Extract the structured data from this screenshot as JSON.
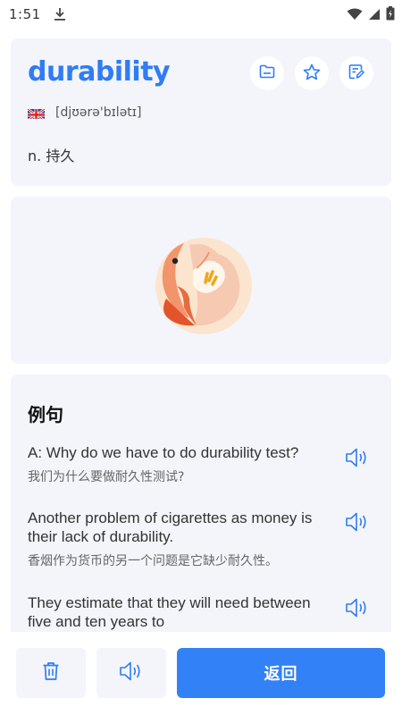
{
  "status_bar": {
    "time": "1:51"
  },
  "word_card": {
    "word": "durability",
    "phonetic": "[djʊərə'bɪlətɪ]",
    "definition": "n. 持久"
  },
  "examples": {
    "title": "例句",
    "items": [
      {
        "en": "A: Why do we have to do durability test?",
        "zh": "我们为什么要做耐久性测试?"
      },
      {
        "en": "Another problem of cigarettes as money is their lack of durability.",
        "zh": "香烟作为货币的另一个问题是它缺少耐久性。"
      },
      {
        "en": "They estimate that they will need between five and ten years to",
        "zh": ""
      }
    ]
  },
  "bottom_bar": {
    "back_label": "返回"
  },
  "colors": {
    "accent": "#2f7cf5",
    "card_bg": "#f3f5fa",
    "button_primary": "#3381f6"
  }
}
